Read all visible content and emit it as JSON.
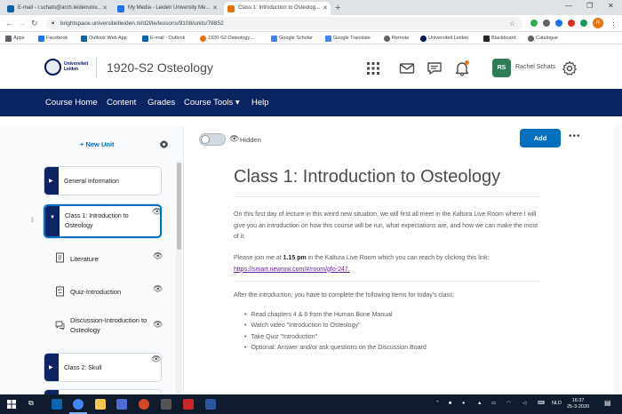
{
  "browser": {
    "tabs": [
      {
        "label": "E-mail - r.schats@arch.leidenuniv...",
        "favicon_color": "#0a64ad",
        "active": false
      },
      {
        "label": "My Media - Leiden University Me...",
        "favicon_color": "#1a73e8",
        "active": false
      },
      {
        "label": "Class 1: Introduction to Osteolog...",
        "favicon_color": "#e8710a",
        "active": true
      }
    ],
    "new_tab": "+",
    "url": "brightspace.universiteitleiden.nl/d2l/le/lessons/9108/units/78852",
    "bookmarks": [
      {
        "label": "Apps",
        "color": "#5f6368"
      },
      {
        "label": "Facebook",
        "color": "#1877f2"
      },
      {
        "label": "Outlook Web App",
        "color": "#0a64ad"
      },
      {
        "label": "E-mail - Outlook",
        "color": "#0a64ad"
      },
      {
        "label": "1920-S2 Osteology,...",
        "color": "#e8710a"
      },
      {
        "label": "Google Scholar",
        "color": "#4285f4"
      },
      {
        "label": "Google Translate",
        "color": "#4285f4"
      },
      {
        "label": "Remote",
        "color": "#5f6368"
      },
      {
        "label": "Universiteit Leiden",
        "color": "#001158"
      },
      {
        "label": "Blackboard",
        "color": "#262626"
      },
      {
        "label": "Catalogue",
        "color": "#5f6368"
      }
    ],
    "profile_initial": "R"
  },
  "header": {
    "logo_text": "Universiteit Leiden",
    "course_title": "1920-S2 Osteology",
    "user_initials": "RS",
    "user_name": "Rachel Schats",
    "accent_color": "#0c2462"
  },
  "nav": {
    "items": [
      "Course Home",
      "Content",
      "Grades",
      "Course Tools",
      "Help"
    ],
    "course_tools_chevron": "▾"
  },
  "sidebar": {
    "new_unit": "+ New Unit",
    "units": [
      {
        "label": "General Information"
      },
      {
        "label": "Class 1: Introduction to Osteology"
      },
      {
        "label": "Class 2: Skull"
      }
    ],
    "sub_items": [
      {
        "label": "Literature"
      },
      {
        "label": "Quiz-Introduction"
      },
      {
        "label": "Discussion-Introduction to Osteology"
      }
    ]
  },
  "lesson": {
    "visibility_label": "Hidden",
    "add_button": "Add",
    "more_button": "•••",
    "title": "Class 1: Introduction to Osteology",
    "paragraph1": "On this first day of lecture in this weird new situation, we will first all meet in the Kaltura Live Room where I will give you an introduction on how this course will be run, what expectations are, and how we can make the most of it.",
    "paragraph2_pre": "Please join me at ",
    "paragraph2_time": "1.15 pm",
    "paragraph2_mid": " in the Kaltura Live Room which you can reach by clicking this link: ",
    "paragraph2_link": "https://smart.newrow.com/#/room/gfo-247.",
    "paragraph3": "After the introduction, you have to complete the following items for today's class:",
    "bullets": [
      "Read chapters 4 & 6 from the Human Bone Manual",
      "Watch video \"Introduction to Osteology\"",
      "Take Quiz \"Introduction\"",
      "Optional: Answer and/or ask questions on the Discussion Board"
    ]
  },
  "taskbar": {
    "language": "NLD",
    "time": "16:37",
    "date": "25-3-2020"
  }
}
